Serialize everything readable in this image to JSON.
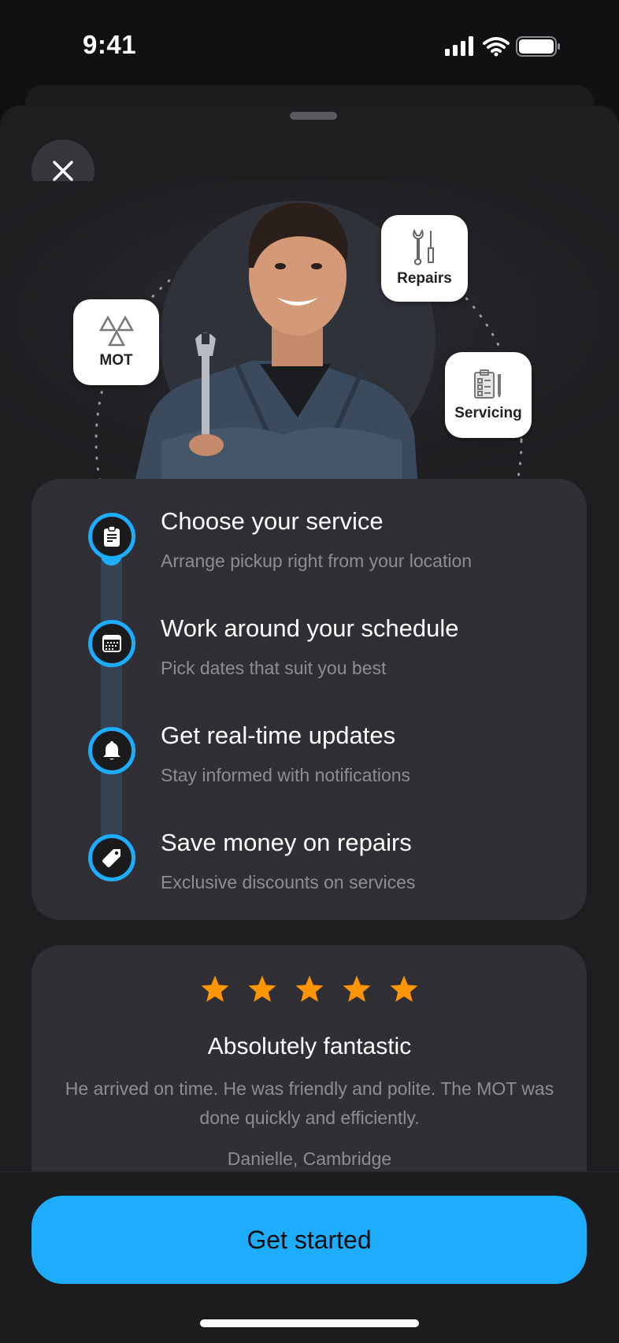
{
  "status_bar": {
    "time": "9:41",
    "icons": [
      "cellular-signal-icon",
      "wifi-icon",
      "battery-icon"
    ]
  },
  "sheet": {
    "close_icon": "close-icon"
  },
  "hero": {
    "image_description": "Smiling mechanic in dark overalls holding a wrench, arms crossed",
    "badges": [
      {
        "label": "MOT",
        "icon": "mot-triangles-icon"
      },
      {
        "label": "Repairs",
        "icon": "wrench-screwdriver-icon"
      },
      {
        "label": "Servicing",
        "icon": "clipboard-checklist-icon"
      }
    ]
  },
  "steps": {
    "progress_active_step": 1,
    "progress_total_steps": 4,
    "items": [
      {
        "title": "Choose your service",
        "subtitle": "Arrange pickup right from your location",
        "icon": "clipboard-icon"
      },
      {
        "title": "Work around your schedule",
        "subtitle": "Pick dates that suit you best",
        "icon": "calendar-icon"
      },
      {
        "title": "Get real-time updates",
        "subtitle": "Stay informed with notifications",
        "icon": "bell-icon"
      },
      {
        "title": "Save money on repairs",
        "subtitle": "Exclusive discounts on services",
        "icon": "tag-icon"
      }
    ]
  },
  "review": {
    "rating": 5,
    "rating_max": 5,
    "title": "Absolutely fantastic",
    "body": "He arrived on time. He was friendly and polite. The MOT was done quickly and efficiently.",
    "author": "Danielle, Cambridge"
  },
  "cta": {
    "label": "Get started"
  },
  "colors": {
    "accent": "#1dadfc",
    "star": "#ff9500",
    "card_bg": "#2f2f34",
    "sheet_bg": "#1e1e21",
    "muted_text": "#8d8d93"
  }
}
